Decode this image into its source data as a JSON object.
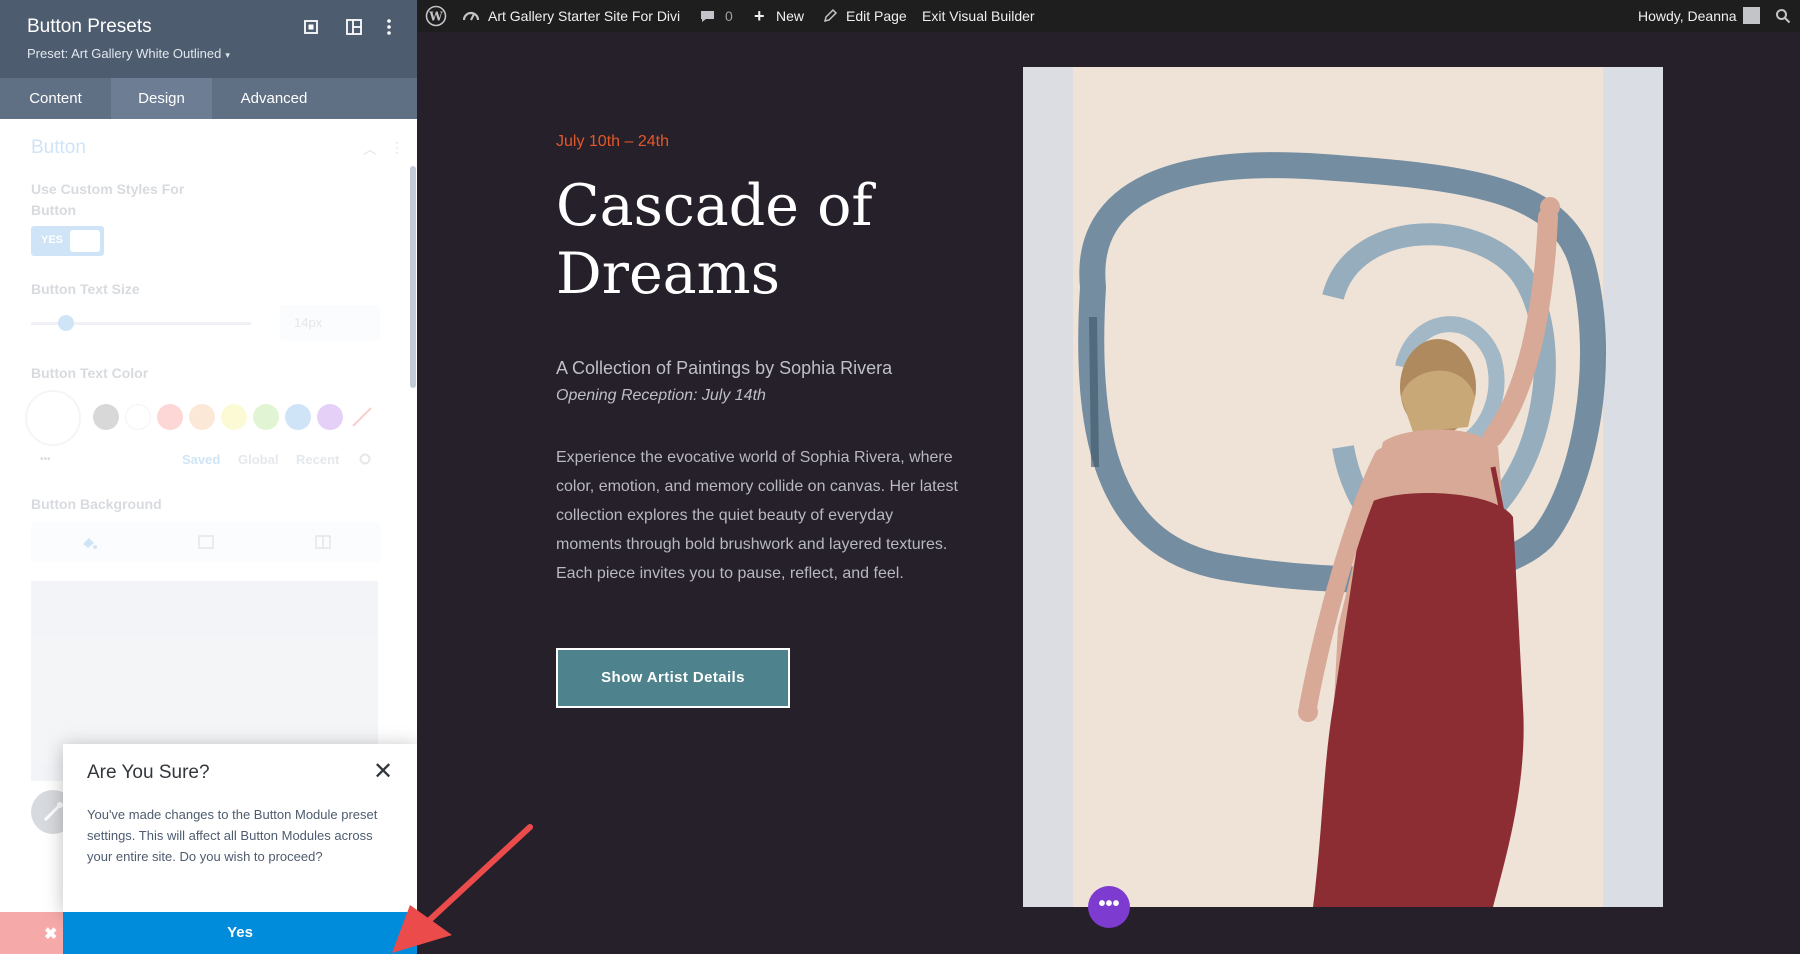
{
  "panel": {
    "title": "Button Presets",
    "preset_label": "Preset: Art Gallery White Outlined",
    "preset_caret": "▾",
    "tabs": [
      {
        "label": "Content",
        "active": false
      },
      {
        "label": "Design",
        "active": true
      },
      {
        "label": "Advanced",
        "active": false
      }
    ],
    "section_title": "Button",
    "fields": {
      "custom_styles_label": "Use Custom Styles For Button",
      "toggle_value": "YES",
      "text_size_label": "Button Text Size",
      "text_size_value": "14px",
      "text_color_label": "Button Text Color",
      "swatch_tabs": [
        "Saved",
        "Global",
        "Recent"
      ],
      "swatch_more": "•••",
      "background_label": "Button Background"
    },
    "swatch_colors": [
      "#545454",
      "#ffffff",
      "#f84b4b",
      "#f39c4a",
      "#f5e93e",
      "#7ad03a",
      "#2b87da",
      "#8c2fe0"
    ]
  },
  "dialog": {
    "title": "Are You Sure?",
    "close": "✕",
    "message": "You've made changes to the Button Module preset settings. This will affect all Button Modules across your entire site. Do you wish to proceed?",
    "confirm_label": "Yes",
    "cancel_label": "✖"
  },
  "adminbar": {
    "site_name": "Art Gallery Starter Site For Divi",
    "comments_count": "0",
    "new_label": "New",
    "edit_page": "Edit Page",
    "exit_builder": "Exit Visual Builder",
    "greeting": "Howdy, Deanna"
  },
  "page": {
    "date": "July 10th – 24th",
    "headline": "Cascade of Dreams",
    "subtitle": "A Collection of Paintings by Sophia Rivera",
    "reception": "Opening Reception: July 14th",
    "body": "Experience the evocative world of Sophia Rivera, where color, emotion, and memory collide on canvas. Her latest collection explores the quiet beauty of everyday moments through bold brushwork and layered textures. Each piece invites you to pause, reflect, and feel.",
    "button_label": "Show Artist Details",
    "dots_label": "•••"
  },
  "colors": {
    "accent_date": "#e3582a",
    "button_teal": "#4e838d",
    "page_bg": "#25202a",
    "confirm_blue": "#008bdb",
    "dots_purple": "#7e3bd0"
  }
}
